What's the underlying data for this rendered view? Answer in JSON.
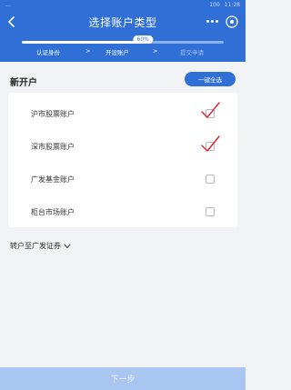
{
  "status_bar": {
    "left_text": "…",
    "battery": "100",
    "time": "11:28"
  },
  "header": {
    "title": "选择账户类型"
  },
  "progress": {
    "percent_label": "60%",
    "fraction": 0.6,
    "steps": [
      {
        "label": "认证身份",
        "state": "done"
      },
      {
        "label": "开设账户",
        "state": "current"
      },
      {
        "label": "提交申请",
        "state": "pending"
      }
    ],
    "separator": ">"
  },
  "section": {
    "title": "新开户",
    "select_all": "一键全选"
  },
  "accounts": [
    {
      "label": "沪市股票账户",
      "checked": true
    },
    {
      "label": "深市股票账户",
      "checked": true
    },
    {
      "label": "广发基金账户",
      "checked": false
    },
    {
      "label": "柜台市场账户",
      "checked": false
    }
  ],
  "transfer": {
    "label": "转户至广发证券"
  },
  "footer": {
    "next_label": "下一步"
  },
  "colors": {
    "primary": "#2f6fd6",
    "background": "#f2f3f5",
    "check": "#e0202a",
    "next_disabled": "#a9c6f2"
  },
  "icons": {
    "back": "chevron-left-icon",
    "more": "more-dots-icon",
    "target": "target-icon",
    "check": "check-mark-icon",
    "expand": "chevron-down-icon"
  }
}
